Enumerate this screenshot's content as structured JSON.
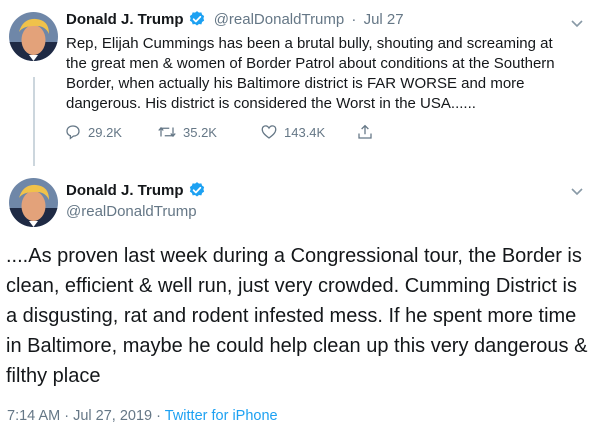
{
  "tweet_reply": {
    "author_name": "Donald J. Trump",
    "handle": "@realDonaldTrump",
    "separator": "·",
    "date": "Jul 27",
    "text": "Rep, Elijah Cummings has been a brutal bully, shouting and screaming at the great men & women of Border Patrol about conditions at the Southern Border, when actually his Baltimore district is FAR WORSE and more dangerous. His district is considered the Worst in the USA......",
    "replies": "29.2K",
    "retweets": "35.2K",
    "likes": "143.4K"
  },
  "tweet_main": {
    "author_name": "Donald J. Trump",
    "handle": "@realDonaldTrump",
    "text": "....As proven last week during a Congressional tour, the Border is clean, efficient & well run, just very crowded. Cumming District is a disgusting, rat and rodent infested mess. If he spent more time in Baltimore, maybe he could help clean up this very dangerous & filthy place",
    "time": "7:14 AM",
    "separator_1": "·",
    "date": "Jul 27, 2019",
    "separator_2": "·",
    "source": "Twitter for iPhone"
  },
  "colors": {
    "verified": "#1da1f2",
    "muted": "#657786",
    "thread_line": "#ccd6dd"
  },
  "icons": [
    "avatar",
    "verified-badge-icon",
    "chevron-down-icon",
    "reply-icon",
    "retweet-icon",
    "like-icon",
    "share-icon"
  ]
}
